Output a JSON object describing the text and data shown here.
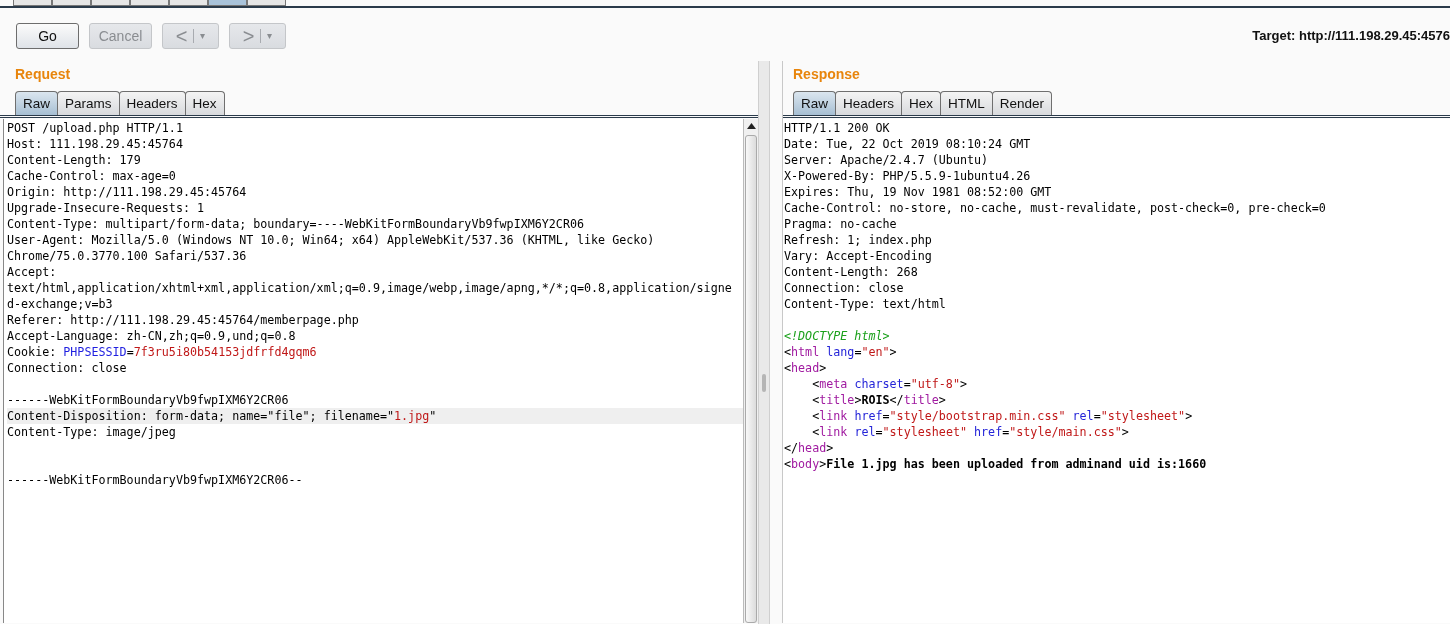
{
  "top_tabs": [
    {
      "selected": false
    },
    {
      "selected": false
    },
    {
      "selected": false
    },
    {
      "selected": false
    },
    {
      "selected": false
    },
    {
      "selected": true
    },
    {
      "selected": false
    }
  ],
  "toolbar": {
    "buttons": [
      {
        "kind": "text",
        "label": "Go",
        "disabled": false
      },
      {
        "kind": "text",
        "label": "Cancel",
        "disabled": true
      },
      {
        "kind": "split",
        "label": "<",
        "menu": "▾",
        "disabled": true
      },
      {
        "kind": "split",
        "label": ">",
        "menu": "▾",
        "disabled": true
      }
    ],
    "target": "Target: http://111.198.29.45:4576"
  },
  "request": {
    "title": "Request",
    "tabs": [
      {
        "label": "Raw",
        "selected": true
      },
      {
        "label": "Params",
        "selected": false
      },
      {
        "label": "Headers",
        "selected": false
      },
      {
        "label": "Hex",
        "selected": false
      }
    ],
    "lines": [
      {
        "kind": "text",
        "highlighted": false,
        "parts": [
          {
            "kind": "plain",
            "t": "POST /upload.php HTTP/1.1"
          }
        ]
      },
      {
        "kind": "text",
        "highlighted": false,
        "parts": [
          {
            "kind": "plain",
            "t": "Host: 111.198.29.45:45764"
          }
        ]
      },
      {
        "kind": "text",
        "highlighted": false,
        "parts": [
          {
            "kind": "plain",
            "t": "Content-Length: 179"
          }
        ]
      },
      {
        "kind": "text",
        "highlighted": false,
        "parts": [
          {
            "kind": "plain",
            "t": "Cache-Control: max-age=0"
          }
        ]
      },
      {
        "kind": "text",
        "highlighted": false,
        "parts": [
          {
            "kind": "plain",
            "t": "Origin: http://111.198.29.45:45764"
          }
        ]
      },
      {
        "kind": "text",
        "highlighted": false,
        "parts": [
          {
            "kind": "plain",
            "t": "Upgrade-Insecure-Requests: 1"
          }
        ]
      },
      {
        "kind": "text",
        "highlighted": false,
        "parts": [
          {
            "kind": "plain",
            "t": "Content-Type: multipart/form-data; boundary=----WebKitFormBoundaryVb9fwpIXM6Y2CR06"
          }
        ]
      },
      {
        "kind": "text",
        "highlighted": false,
        "parts": [
          {
            "kind": "plain",
            "t": "User-Agent: Mozilla/5.0 (Windows NT 10.0; Win64; x64) AppleWebKit/537.36 (KHTML, like Gecko)"
          }
        ]
      },
      {
        "kind": "text",
        "highlighted": false,
        "parts": [
          {
            "kind": "plain",
            "t": "Chrome/75.0.3770.100 Safari/537.36"
          }
        ]
      },
      {
        "kind": "text",
        "highlighted": false,
        "parts": [
          {
            "kind": "plain",
            "t": "Accept:"
          }
        ]
      },
      {
        "kind": "text",
        "highlighted": false,
        "parts": [
          {
            "kind": "plain",
            "t": "text/html,application/xhtml+xml,application/xml;q=0.9,image/webp,image/apng,*/*;q=0.8,application/signe"
          }
        ]
      },
      {
        "kind": "text",
        "highlighted": false,
        "parts": [
          {
            "kind": "plain",
            "t": "d-exchange;v=b3"
          }
        ]
      },
      {
        "kind": "text",
        "highlighted": false,
        "parts": [
          {
            "kind": "plain",
            "t": "Referer: http://111.198.29.45:45764/memberpage.php"
          }
        ]
      },
      {
        "kind": "text",
        "highlighted": false,
        "parts": [
          {
            "kind": "plain",
            "t": "Accept-Language: zh-CN,zh;q=0.9,und;q=0.8"
          }
        ]
      },
      {
        "kind": "text",
        "highlighted": false,
        "parts": [
          {
            "kind": "plain",
            "t": "Cookie: "
          },
          {
            "kind": "name",
            "t": "PHPSESSID"
          },
          {
            "kind": "plain",
            "t": "="
          },
          {
            "kind": "value",
            "t": "7f3ru5i80b54153jdfrfd4gqm6"
          }
        ]
      },
      {
        "kind": "text",
        "highlighted": false,
        "parts": [
          {
            "kind": "plain",
            "t": "Connection: close"
          }
        ]
      },
      {
        "kind": "blank"
      },
      {
        "kind": "text",
        "highlighted": false,
        "parts": [
          {
            "kind": "plain",
            "t": "------WebKitFormBoundaryVb9fwpIXM6Y2CR06"
          }
        ]
      },
      {
        "kind": "text",
        "highlighted": true,
        "parts": [
          {
            "kind": "plain",
            "t": "Content-Disposition: form-data; name=\"file\"; filename=\""
          },
          {
            "kind": "value",
            "t": "1.jpg"
          },
          {
            "kind": "plain",
            "t": "\""
          }
        ]
      },
      {
        "kind": "text",
        "highlighted": false,
        "parts": [
          {
            "kind": "plain",
            "t": "Content-Type: image/jpeg"
          }
        ]
      },
      {
        "kind": "blank"
      },
      {
        "kind": "blank"
      },
      {
        "kind": "text",
        "highlighted": false,
        "parts": [
          {
            "kind": "plain",
            "t": "------WebKitFormBoundaryVb9fwpIXM6Y2CR06--"
          }
        ]
      }
    ]
  },
  "response": {
    "title": "Response",
    "tabs": [
      {
        "label": "Raw",
        "selected": true
      },
      {
        "label": "Headers",
        "selected": false
      },
      {
        "label": "Hex",
        "selected": false
      },
      {
        "label": "HTML",
        "selected": false
      },
      {
        "label": "Render",
        "selected": false
      }
    ],
    "lines": [
      {
        "kind": "text",
        "parts": [
          {
            "kind": "plain",
            "t": "HTTP/1.1 200 OK"
          }
        ]
      },
      {
        "kind": "text",
        "parts": [
          {
            "kind": "plain",
            "t": "Date: Tue, 22 Oct 2019 08:10:24 GMT"
          }
        ]
      },
      {
        "kind": "text",
        "parts": [
          {
            "kind": "plain",
            "t": "Server: Apache/2.4.7 (Ubuntu)"
          }
        ]
      },
      {
        "kind": "text",
        "parts": [
          {
            "kind": "plain",
            "t": "X-Powered-By: PHP/5.5.9-1ubuntu4.26"
          }
        ]
      },
      {
        "kind": "text",
        "parts": [
          {
            "kind": "plain",
            "t": "Expires: Thu, 19 Nov 1981 08:52:00 GMT"
          }
        ]
      },
      {
        "kind": "text",
        "parts": [
          {
            "kind": "plain",
            "t": "Cache-Control: no-store, no-cache, must-revalidate, post-check=0, pre-check=0"
          }
        ]
      },
      {
        "kind": "text",
        "parts": [
          {
            "kind": "plain",
            "t": "Pragma: no-cache"
          }
        ]
      },
      {
        "kind": "text",
        "parts": [
          {
            "kind": "plain",
            "t": "Refresh: 1; index.php"
          }
        ]
      },
      {
        "kind": "text",
        "parts": [
          {
            "kind": "plain",
            "t": "Vary: Accept-Encoding"
          }
        ]
      },
      {
        "kind": "text",
        "parts": [
          {
            "kind": "plain",
            "t": "Content-Length: 268"
          }
        ]
      },
      {
        "kind": "text",
        "parts": [
          {
            "kind": "plain",
            "t": "Connection: close"
          }
        ]
      },
      {
        "kind": "text",
        "parts": [
          {
            "kind": "plain",
            "t": "Content-Type: text/html"
          }
        ]
      },
      {
        "kind": "blank"
      },
      {
        "kind": "text",
        "parts": [
          {
            "kind": "doctype",
            "t": "<!DOCTYPE html>"
          }
        ]
      },
      {
        "kind": "text",
        "parts": [
          {
            "kind": "plain",
            "t": "<"
          },
          {
            "kind": "tag",
            "t": "html"
          },
          {
            "kind": "attr",
            "t": " lang"
          },
          {
            "kind": "plain",
            "t": "="
          },
          {
            "kind": "value",
            "t": "\"en\""
          },
          {
            "kind": "plain",
            "t": ">"
          }
        ]
      },
      {
        "kind": "text",
        "parts": [
          {
            "kind": "plain",
            "t": "<"
          },
          {
            "kind": "tag",
            "t": "head"
          },
          {
            "kind": "plain",
            "t": ">"
          }
        ]
      },
      {
        "kind": "text",
        "parts": [
          {
            "kind": "plain",
            "t": "    <"
          },
          {
            "kind": "tag",
            "t": "meta"
          },
          {
            "kind": "attr",
            "t": " charset"
          },
          {
            "kind": "plain",
            "t": "="
          },
          {
            "kind": "value",
            "t": "\"utf-8\""
          },
          {
            "kind": "plain",
            "t": ">"
          }
        ]
      },
      {
        "kind": "text",
        "parts": [
          {
            "kind": "plain",
            "t": "    <"
          },
          {
            "kind": "tag",
            "t": "title"
          },
          {
            "kind": "plain",
            "t": ">"
          },
          {
            "kind": "bold",
            "t": "ROIS"
          },
          {
            "kind": "plain",
            "t": "</"
          },
          {
            "kind": "tag",
            "t": "title"
          },
          {
            "kind": "plain",
            "t": ">"
          }
        ]
      },
      {
        "kind": "text",
        "parts": [
          {
            "kind": "plain",
            "t": "    <"
          },
          {
            "kind": "tag",
            "t": "link"
          },
          {
            "kind": "attr",
            "t": " href"
          },
          {
            "kind": "plain",
            "t": "="
          },
          {
            "kind": "value",
            "t": "\"style/bootstrap.min.css\""
          },
          {
            "kind": "attr",
            "t": " rel"
          },
          {
            "kind": "plain",
            "t": "="
          },
          {
            "kind": "value",
            "t": "\"stylesheet\""
          },
          {
            "kind": "plain",
            "t": ">"
          }
        ]
      },
      {
        "kind": "text",
        "parts": [
          {
            "kind": "plain",
            "t": "    <"
          },
          {
            "kind": "tag",
            "t": "link"
          },
          {
            "kind": "attr",
            "t": " rel"
          },
          {
            "kind": "plain",
            "t": "="
          },
          {
            "kind": "value",
            "t": "\"stylesheet\""
          },
          {
            "kind": "attr",
            "t": " href"
          },
          {
            "kind": "plain",
            "t": "="
          },
          {
            "kind": "value",
            "t": "\"style/main.css\""
          },
          {
            "kind": "plain",
            "t": ">"
          }
        ]
      },
      {
        "kind": "text",
        "parts": [
          {
            "kind": "plain",
            "t": "</"
          },
          {
            "kind": "tag",
            "t": "head"
          },
          {
            "kind": "plain",
            "t": ">"
          }
        ]
      },
      {
        "kind": "text",
        "parts": [
          {
            "kind": "plain",
            "t": "<"
          },
          {
            "kind": "tag",
            "t": "body"
          },
          {
            "kind": "plain",
            "t": ">"
          },
          {
            "kind": "bold",
            "t": "File 1.jpg has been uploaded from adminand uid is:1660"
          }
        ]
      }
    ]
  }
}
